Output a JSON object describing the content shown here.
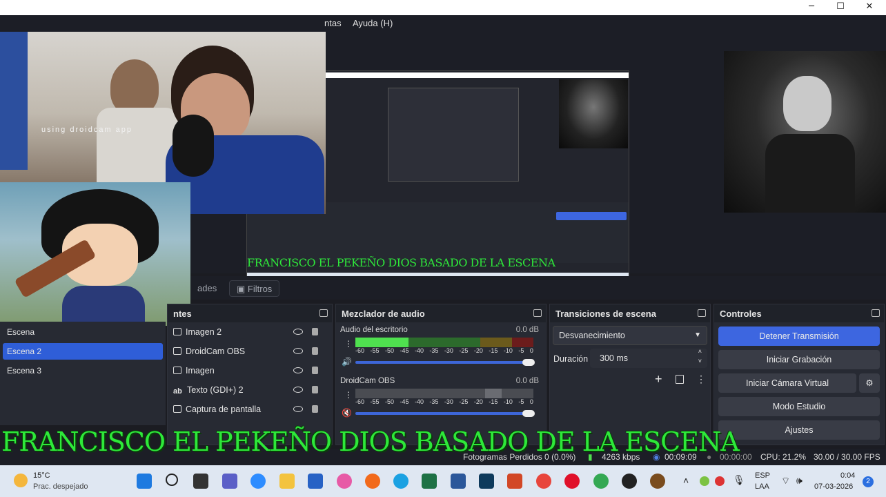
{
  "window": {
    "controls": [
      "─",
      "☐",
      "✕"
    ]
  },
  "menu": {
    "items": [
      "ntas",
      "Ayuda (H)"
    ]
  },
  "preview": {
    "webcam_caption": "using droidcam app",
    "inner_overlay_text": "FRANCISCO EL PEKEÑO DIOS BASADO DE LA ESCENA"
  },
  "dock_tabs": {
    "items": [
      "ades",
      "Filtros"
    ]
  },
  "scenes": {
    "items": [
      "Escena",
      "Escena 2",
      "Escena 3"
    ],
    "selected": 1
  },
  "sources": {
    "title": "ntes",
    "items": [
      "Imagen 2",
      "DroidCam OBS",
      "Imagen",
      "Texto (GDI+) 2",
      "Captura de pantalla"
    ]
  },
  "mixer": {
    "title": "Mezclador de audio",
    "channels": [
      {
        "name": "Audio del escritorio",
        "db": "0.0 dB",
        "level": 0.3
      },
      {
        "name": "DroidCam OBS",
        "db": "0.0 dB",
        "level": 0.0
      }
    ],
    "ticks": [
      "-60",
      "-55",
      "-50",
      "-45",
      "-40",
      "-35",
      "-30",
      "-25",
      "-20",
      "-15",
      "-10",
      "-5",
      "0"
    ]
  },
  "transitions": {
    "title": "Transiciones de escena",
    "selected": "Desvanecimiento",
    "duration_label": "Duración",
    "duration_value": "300 ms"
  },
  "controls": {
    "title": "Controles",
    "buttons": [
      "Detener Transmisión",
      "Iniciar Grabación",
      "Iniciar Cámara Virtual",
      "Modo Estudio",
      "Ajustes"
    ]
  },
  "overlay_text": "FRANCISCO EL PEKEÑO DIOS BASADO DE LA ESCENA",
  "status": {
    "dropped": "Fotogramas Perdidos 0 (0.0%)",
    "bitrate": "4263 kbps",
    "stream_time": "00:09:09",
    "rec_time": "00:00:00",
    "cpu": "CPU: 21.2%",
    "fps": "30.00 / 30.00 FPS"
  },
  "taskbar": {
    "weather_temp": "15°C",
    "weather_desc": "Prac. despejado",
    "lang": "ESP",
    "lang2": "LAA",
    "time": "0:04",
    "date": "07-03-2026",
    "notif": "2",
    "colors": {
      "accent": "#2f5ed8",
      "overlay_green": "#2ee83a",
      "stream_btn": "#3d66e0"
    }
  }
}
